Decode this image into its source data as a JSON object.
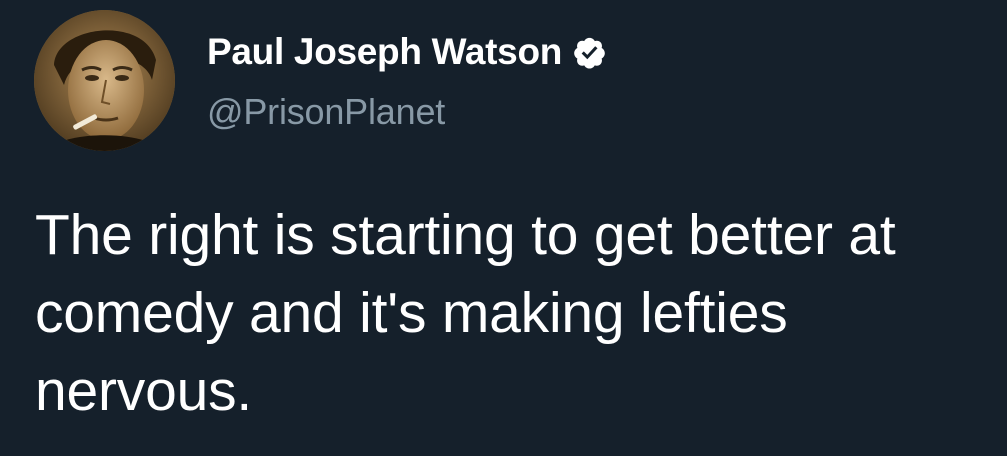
{
  "author": {
    "display_name": "Paul Joseph Watson",
    "handle": "@PrisonPlanet",
    "verified_icon": "verified-badge-icon"
  },
  "tweet": {
    "text": "The right is starting to get better at comedy and it's making lefties nervous."
  },
  "colors": {
    "background": "#15202b",
    "name": "#ffffff",
    "handle": "#8899a6",
    "text": "#ffffff"
  }
}
